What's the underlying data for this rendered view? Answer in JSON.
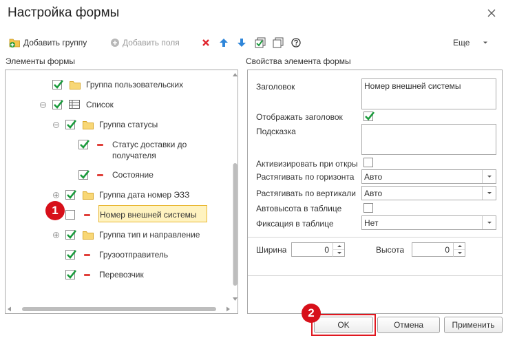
{
  "window": {
    "title": "Настройка формы"
  },
  "toolbar": {
    "add_group": "Добавить группу",
    "add_fields": "Добавить поля",
    "more": "Еще"
  },
  "sections": {
    "left": "Элементы формы",
    "right": "Свойства элемента формы"
  },
  "tree": {
    "items": [
      {
        "label": "Группа пользовательских",
        "checked": true,
        "type": "group"
      },
      {
        "label": "Список",
        "checked": true,
        "type": "table",
        "expander": "minus"
      },
      {
        "label": "Группа статусы",
        "checked": true,
        "type": "group",
        "expander": "minus"
      },
      {
        "label_line1": "Статус доставки до",
        "label_line2": "получателя",
        "checked": true,
        "type": "field"
      },
      {
        "label": "Состояние",
        "checked": true,
        "type": "field"
      },
      {
        "label": "Группа дата номер ЭЗЗ",
        "checked": true,
        "type": "group",
        "expander": "plus"
      },
      {
        "label": "Номер внешней системы",
        "checked": false,
        "type": "field",
        "selected": true
      },
      {
        "label": "Группа тип и направление",
        "checked": true,
        "type": "group",
        "expander": "plus"
      },
      {
        "label": "Грузоотправитель",
        "checked": true,
        "type": "field"
      },
      {
        "label": "Перевозчик",
        "checked": true,
        "type": "field"
      }
    ]
  },
  "properties": {
    "title_label": "Заголовок",
    "title_value": "Номер внешней системы",
    "show_title_label": "Отображать заголовок",
    "show_title_checked": true,
    "hint_label": "Подсказка",
    "hint_value": "",
    "activate_label": "Активизировать при откры",
    "activate_checked": false,
    "stretch_h_label": "Растягивать по горизонта",
    "stretch_h_value": "Авто",
    "stretch_v_label": "Растягивать по вертикали",
    "stretch_v_value": "Авто",
    "autoheight_label": "Автовысота в таблице",
    "autoheight_checked": false,
    "fix_label": "Фиксация в таблице",
    "fix_value": "Нет",
    "width_label": "Ширина",
    "width_value": "0",
    "height_label": "Высота",
    "height_value": "0"
  },
  "buttons": {
    "ok": "OK",
    "cancel": "Отмена",
    "apply": "Применить"
  },
  "annotations": {
    "badge1": "1",
    "badge2": "2"
  },
  "colors": {
    "check": "#1a9b3c",
    "highlight_border": "#e0171f",
    "selection_bg": "#fff3c0",
    "badge": "#d7101a"
  }
}
